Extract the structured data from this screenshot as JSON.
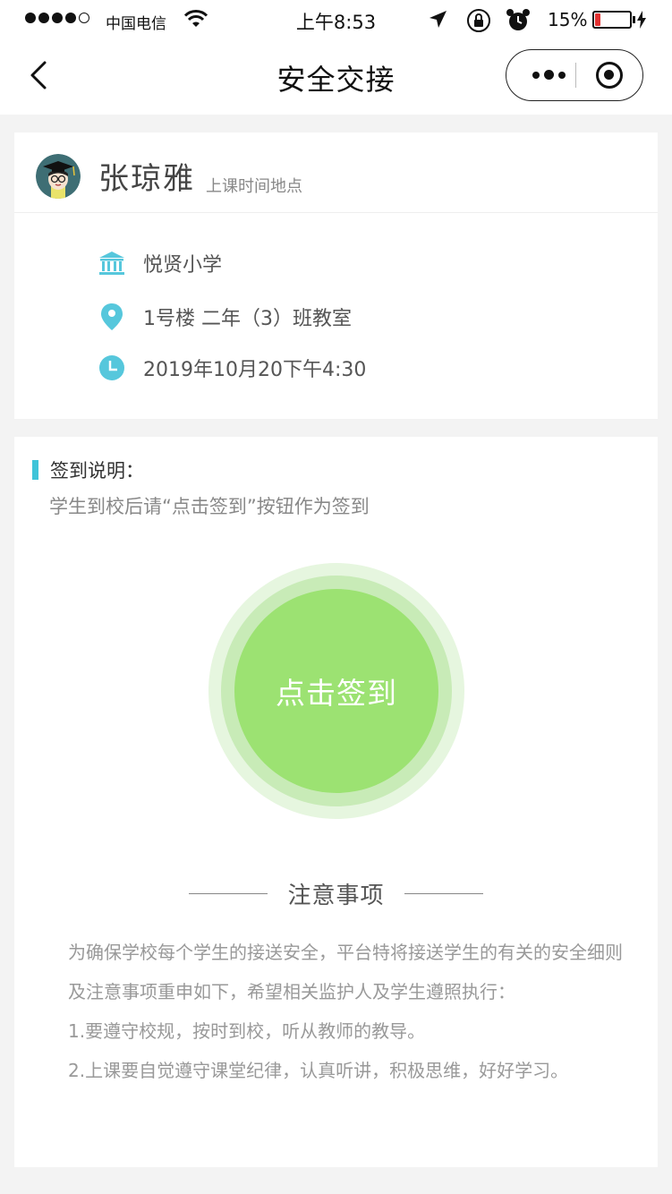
{
  "status_bar": {
    "carrier": "中国电信",
    "time": "上午8:53",
    "battery_percent": "15%",
    "battery_level": 0.15,
    "battery_color": "#e23131"
  },
  "nav": {
    "title": "安全交接",
    "icons": {
      "back": "chevron-left-icon",
      "more": "more-dots-icon",
      "close": "target-circle-icon"
    }
  },
  "teacher": {
    "name": "张琼雅",
    "subtitle": "上课时间地点"
  },
  "info": [
    {
      "icon": "school-icon",
      "text": "悦贤小学"
    },
    {
      "icon": "location-pin-icon",
      "text": "1号楼  二年（3）班教室"
    },
    {
      "icon": "clock-icon",
      "text": "2019年10月20下午4:30"
    }
  ],
  "checkin": {
    "heading": "签到说明：",
    "instruction": "学生到校后请“点击签到”按钮作为签到",
    "button_label": "点击签到"
  },
  "notice": {
    "title": "注意事项",
    "paragraph": "为确保学校每个学生的接送安全，平台特将接送学生的有关的安全细则及注意事项重申如下，希望相关监护人及学生遵照执行：",
    "items": [
      "1.要遵守校规，按时到校，听从教师的教导。",
      "2.上课要自觉遵守课堂纪律，认真听讲，积极思维，好好学习。"
    ]
  },
  "colors": {
    "accent": "#3fc4d9",
    "button_green": "#9ce272",
    "ring_mid": "#c8ebb7",
    "ring_outer": "#e6f6df"
  }
}
